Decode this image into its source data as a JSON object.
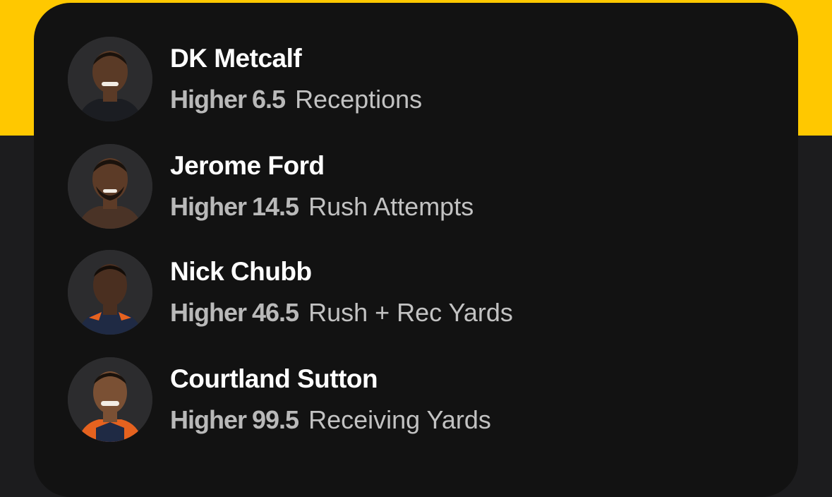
{
  "picks": [
    {
      "player": "DK Metcalf",
      "direction": "Higher",
      "line": "6.5",
      "stat": "Receptions",
      "jersey_color": "#1b1d22",
      "skin_color": "#5a3a26"
    },
    {
      "player": "Jerome Ford",
      "direction": "Higher",
      "line": "14.5",
      "stat": "Rush Attempts",
      "jersey_color": "#4a3326",
      "skin_color": "#5c3b27"
    },
    {
      "player": "Nick Chubb",
      "direction": "Higher",
      "line": "46.5",
      "stat": "Rush + Rec Yards",
      "jersey_color": "#1f2a44",
      "skin_color": "#4a2f20"
    },
    {
      "player": "Courtland Sutton",
      "direction": "Higher",
      "line": "99.5",
      "stat": "Receiving Yards",
      "jersey_color": "#e5621f",
      "skin_color": "#7a5034"
    }
  ],
  "colors": {
    "accent_yellow": "#ffc800",
    "card_background": "#121212",
    "page_background": "#1c1c1e",
    "name_text": "#ffffff",
    "detail_text": "#b9b9b9"
  },
  "icons": [
    "player-headshot-icon"
  ]
}
